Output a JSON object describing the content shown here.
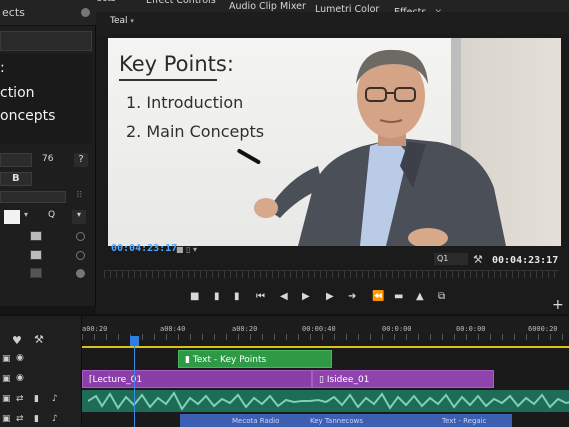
{
  "left_panel": {
    "header_label": "ects",
    "preview_lines": [
      ":",
      "ction",
      "oncepts"
    ],
    "font_size_value": "76",
    "help_label": "?",
    "bold_label": "B",
    "search_label": "Q"
  },
  "tabs": {
    "effect_controls": "Effect Controls",
    "audio_clip_mixer": "Audio Clip Mixer",
    "lumetri_color": "Lumetri Color",
    "effects": "Effects",
    "effects_close": "×"
  },
  "program": {
    "label": "Teal"
  },
  "slide": {
    "title": "Key Points:",
    "points": [
      "1. Introduction",
      "2. Main Concepts"
    ]
  },
  "monitor": {
    "timecode_left": "00:04:23:17",
    "timecode_right": "00:04:23:17",
    "quality": "Q1"
  },
  "transport": {
    "buttons": [
      "■",
      "▮",
      "▮",
      "⏮",
      "◀",
      "▶",
      "▶",
      "➜",
      "⏪",
      "▬",
      "▲",
      "⧉"
    ],
    "add_label": "+"
  },
  "timeline": {
    "ruler_labels": [
      "a00:20",
      "a00:40",
      "a00:20",
      "00:00:40",
      "00:0:00",
      "00:0:00",
      "6000:20"
    ],
    "clips": {
      "text_clip": "Text - Key Points",
      "lecture_clip": "Lecture_01",
      "slide_clip": "Isidee_01",
      "audio2_label_a": "Mecota Radio",
      "audio2_label_b": "Key Tannecows",
      "audio2_label_c": "Text - Regaic"
    }
  },
  "colors": {
    "accent_blue": "#4ea8ff",
    "text_clip": "#2f9a46",
    "video_clip": "#8a3fa8",
    "audio_clip": "#1e6b57",
    "audio2_clip": "#3d5fb2",
    "work_area": "#d8c21a"
  }
}
